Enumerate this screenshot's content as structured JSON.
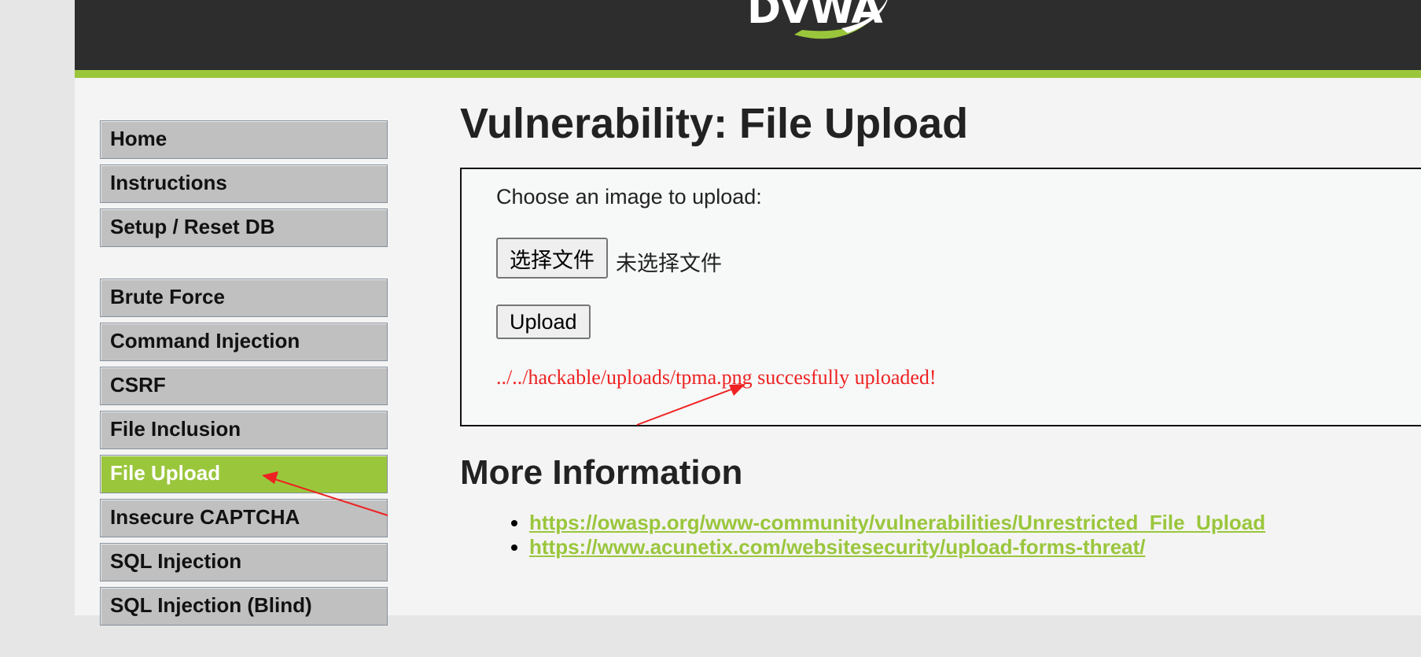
{
  "header": {
    "logo_text": "DVWA"
  },
  "menu": {
    "blocks": [
      [
        "Home",
        "Instructions",
        "Setup / Reset DB"
      ],
      [
        "Brute Force",
        "Command Injection",
        "CSRF",
        "File Inclusion",
        "File Upload",
        "Insecure CAPTCHA",
        "SQL Injection",
        "SQL Injection (Blind)"
      ]
    ],
    "selected": "File Upload"
  },
  "main": {
    "title": "Vulnerability: File Upload",
    "choose_label": "Choose an image to upload:",
    "file_button_label": "选择文件",
    "file_status": "未选择文件",
    "upload_button_label": "Upload",
    "upload_result": "../../hackable/uploads/tpma.png succesfully uploaded!",
    "more_info_title": "More Information",
    "links": [
      "https://owasp.org/www-community/vulnerabilities/Unrestricted_File_Upload",
      "https://www.acunetix.com/websitesecurity/upload-forms-threat/"
    ]
  },
  "annotations": {
    "arrow_color": "#ee2222"
  },
  "colors": {
    "accent": "#9ac63c",
    "header_bg": "#2d2d2d",
    "error_red": "#ee2222"
  }
}
